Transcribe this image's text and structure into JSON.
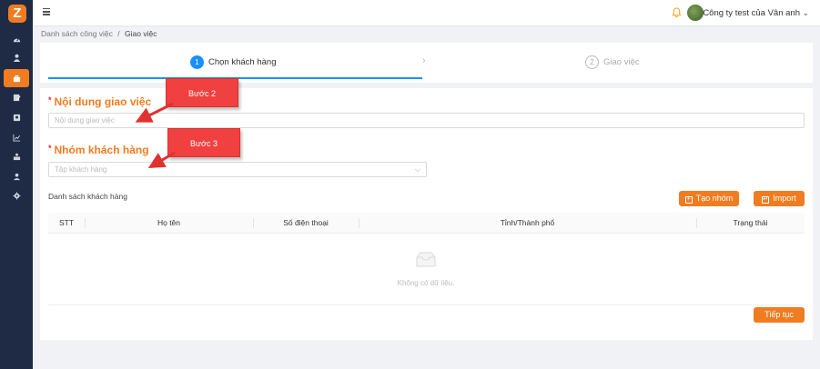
{
  "app": {
    "logo_letter": "Z"
  },
  "sidebar": {
    "items": [
      {
        "icon": "dashboard-icon"
      },
      {
        "icon": "user-icon"
      },
      {
        "icon": "briefcase-icon",
        "active": true
      },
      {
        "icon": "edit-icon"
      },
      {
        "icon": "contact-book-icon"
      },
      {
        "icon": "chart-icon"
      },
      {
        "icon": "inbox-icon"
      },
      {
        "icon": "users-icon"
      },
      {
        "icon": "settings-icon"
      }
    ]
  },
  "header": {
    "company": "Công ty test của Vân anh",
    "caret": "⌄"
  },
  "breadcrumb": {
    "parent": "Danh sách công việc",
    "separator": "/",
    "current": "Giao việc"
  },
  "steps": [
    {
      "number": "1",
      "label": "Chọn khách hàng",
      "active": true
    },
    {
      "number": "2",
      "label": "Giao việc",
      "active": false
    }
  ],
  "form": {
    "task_content": {
      "required_mark": "*",
      "label": "Nội dung giao việc",
      "placeholder": "Nội dung giao việc"
    },
    "customer_group": {
      "required_mark": "*",
      "label": "Nhóm khách hàng",
      "placeholder": "Tập khách hàng"
    }
  },
  "customer_list": {
    "title": "Danh sách khách hàng",
    "create_group_label": "Tạo nhóm",
    "import_label": "Import",
    "columns": [
      "STT",
      "Họ tên",
      "Số điện thoại",
      "Tỉnh/Thành phố",
      "Trạng thái"
    ],
    "rows": [],
    "empty_text": "Không có dữ liệu."
  },
  "footer": {
    "continue_label": "Tiếp tục"
  },
  "annotations": [
    {
      "label": "Bước 2"
    },
    {
      "label": "Bước 3"
    }
  ],
  "colors": {
    "accent": "#f07c21",
    "primary": "#1890ff",
    "sidebar": "#1f2a44",
    "callout": "#f04040",
    "required": "#f5222d"
  }
}
